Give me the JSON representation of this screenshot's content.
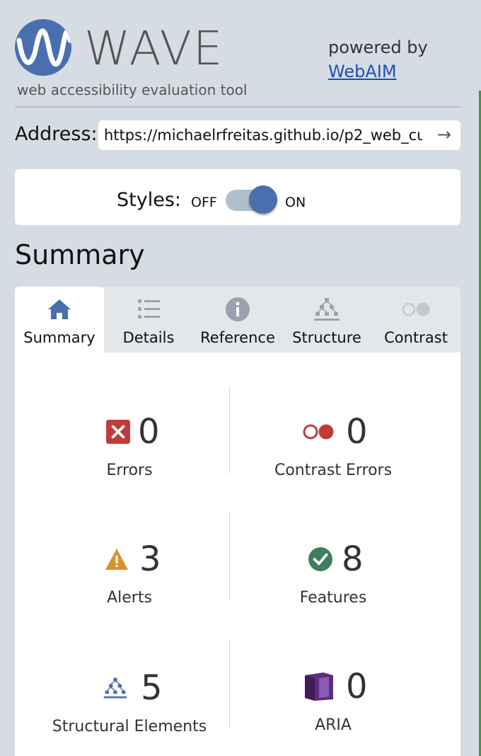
{
  "header": {
    "logo_text": "WAVE",
    "tagline": "web accessibility evaluation tool",
    "powered_by": "powered by",
    "webaim_link": "WebAIM"
  },
  "address": {
    "label": "Address:",
    "value": "https://michaelrfreitas.github.io/p2_web_cu",
    "go_icon": "arrow-right-icon"
  },
  "styles": {
    "label": "Styles:",
    "off": "OFF",
    "on": "ON",
    "state": "on"
  },
  "summary_heading": "Summary",
  "tabs": [
    {
      "label": "Summary",
      "icon": "home-icon",
      "active": true
    },
    {
      "label": "Details",
      "icon": "list-icon",
      "active": false
    },
    {
      "label": "Reference",
      "icon": "info-icon",
      "active": false
    },
    {
      "label": "Structure",
      "icon": "structure-icon",
      "active": false
    },
    {
      "label": "Contrast",
      "icon": "contrast-icon",
      "active": false
    }
  ],
  "stats": {
    "errors": {
      "count": "0",
      "label": "Errors",
      "icon": "error-x-icon"
    },
    "contrast_errors": {
      "count": "0",
      "label": "Contrast Errors",
      "icon": "contrast-error-icon"
    },
    "alerts": {
      "count": "3",
      "label": "Alerts",
      "icon": "alert-triangle-icon"
    },
    "features": {
      "count": "8",
      "label": "Features",
      "icon": "feature-check-icon"
    },
    "structural": {
      "count": "5",
      "label": "Structural Elements",
      "icon": "structure-icon"
    },
    "aria": {
      "count": "0",
      "label": "ARIA",
      "icon": "aria-cube-icon"
    }
  },
  "colors": {
    "brand": "#4a6fb0",
    "error": "#c03b3b",
    "alert": "#d9902e",
    "feature": "#3f7d5e",
    "aria": "#5c2d82",
    "background": "#d6dce3"
  }
}
